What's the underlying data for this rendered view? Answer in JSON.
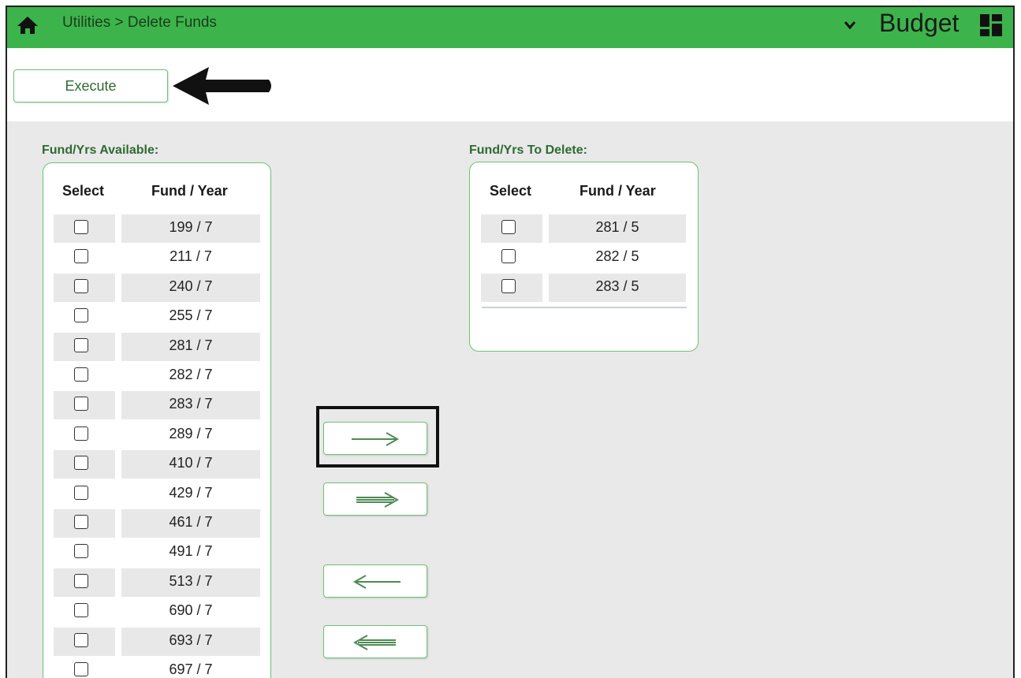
{
  "header": {
    "breadcrumb": "Utilities > Delete Funds",
    "app_title": "Budget",
    "home_icon": "home-icon",
    "dropdown_icon": "chevron-down-icon",
    "grid_icon": "dashboard-grid-icon",
    "bar_color": "#3cb44b"
  },
  "toolbar": {
    "execute_label": "Execute"
  },
  "available": {
    "label": "Fund/Yrs Available:",
    "col_select": "Select",
    "col_fund": "Fund / Year",
    "rows": [
      "199 / 7",
      "211 / 7",
      "240 / 7",
      "255 / 7",
      "281 / 7",
      "282 / 7",
      "283 / 7",
      "289 / 7",
      "410 / 7",
      "429 / 7",
      "461 / 7",
      "491 / 7",
      "513 / 7",
      "690 / 7",
      "693 / 7",
      "697 / 7"
    ]
  },
  "to_delete": {
    "label": "Fund/Yrs To Delete:",
    "col_select": "Select",
    "col_fund": "Fund / Year",
    "rows": [
      "281 / 5",
      "282 / 5",
      "283 / 5"
    ]
  },
  "move_buttons": [
    {
      "name": "move-selected-right-button",
      "icon": "arrow-right-icon"
    },
    {
      "name": "move-all-right-button",
      "icon": "double-arrow-right-icon"
    },
    {
      "name": "move-selected-left-button",
      "icon": "arrow-left-icon"
    },
    {
      "name": "move-all-left-button",
      "icon": "double-arrow-left-icon"
    }
  ]
}
